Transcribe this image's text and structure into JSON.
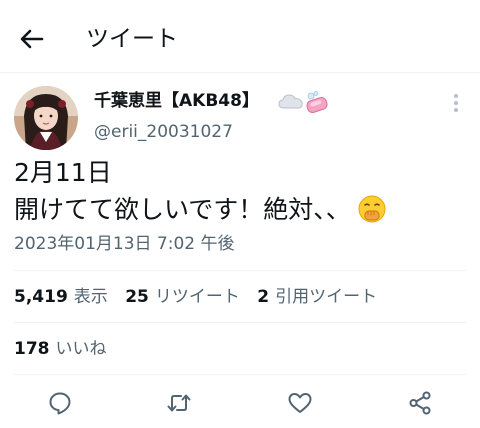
{
  "header": {
    "title": "ツイート"
  },
  "author": {
    "display_name": "千葉恵里【AKB48】",
    "name_emojis": [
      "cloud-emoji",
      "soap-emoji"
    ],
    "handle": "@erii_20031027"
  },
  "tweet": {
    "lines": [
      "2月11日",
      "開けてて欲しいです！絶対、、"
    ],
    "emoji": "shushing-face-emoji",
    "timestamp": "2023年01月13日 7:02 午後"
  },
  "stats": {
    "views": {
      "count": "5,419",
      "label": "表示"
    },
    "retweets": {
      "count": "25",
      "label": "リツイート"
    },
    "quotes": {
      "count": "2",
      "label": "引用ツイート"
    },
    "likes": {
      "count": "178",
      "label": "いいね"
    }
  },
  "actions": [
    "reply-icon",
    "retweet-icon",
    "like-icon",
    "share-icon"
  ],
  "colors": {
    "text": "#0f1419",
    "secondary": "#536471",
    "divider": "#eff3f4"
  }
}
